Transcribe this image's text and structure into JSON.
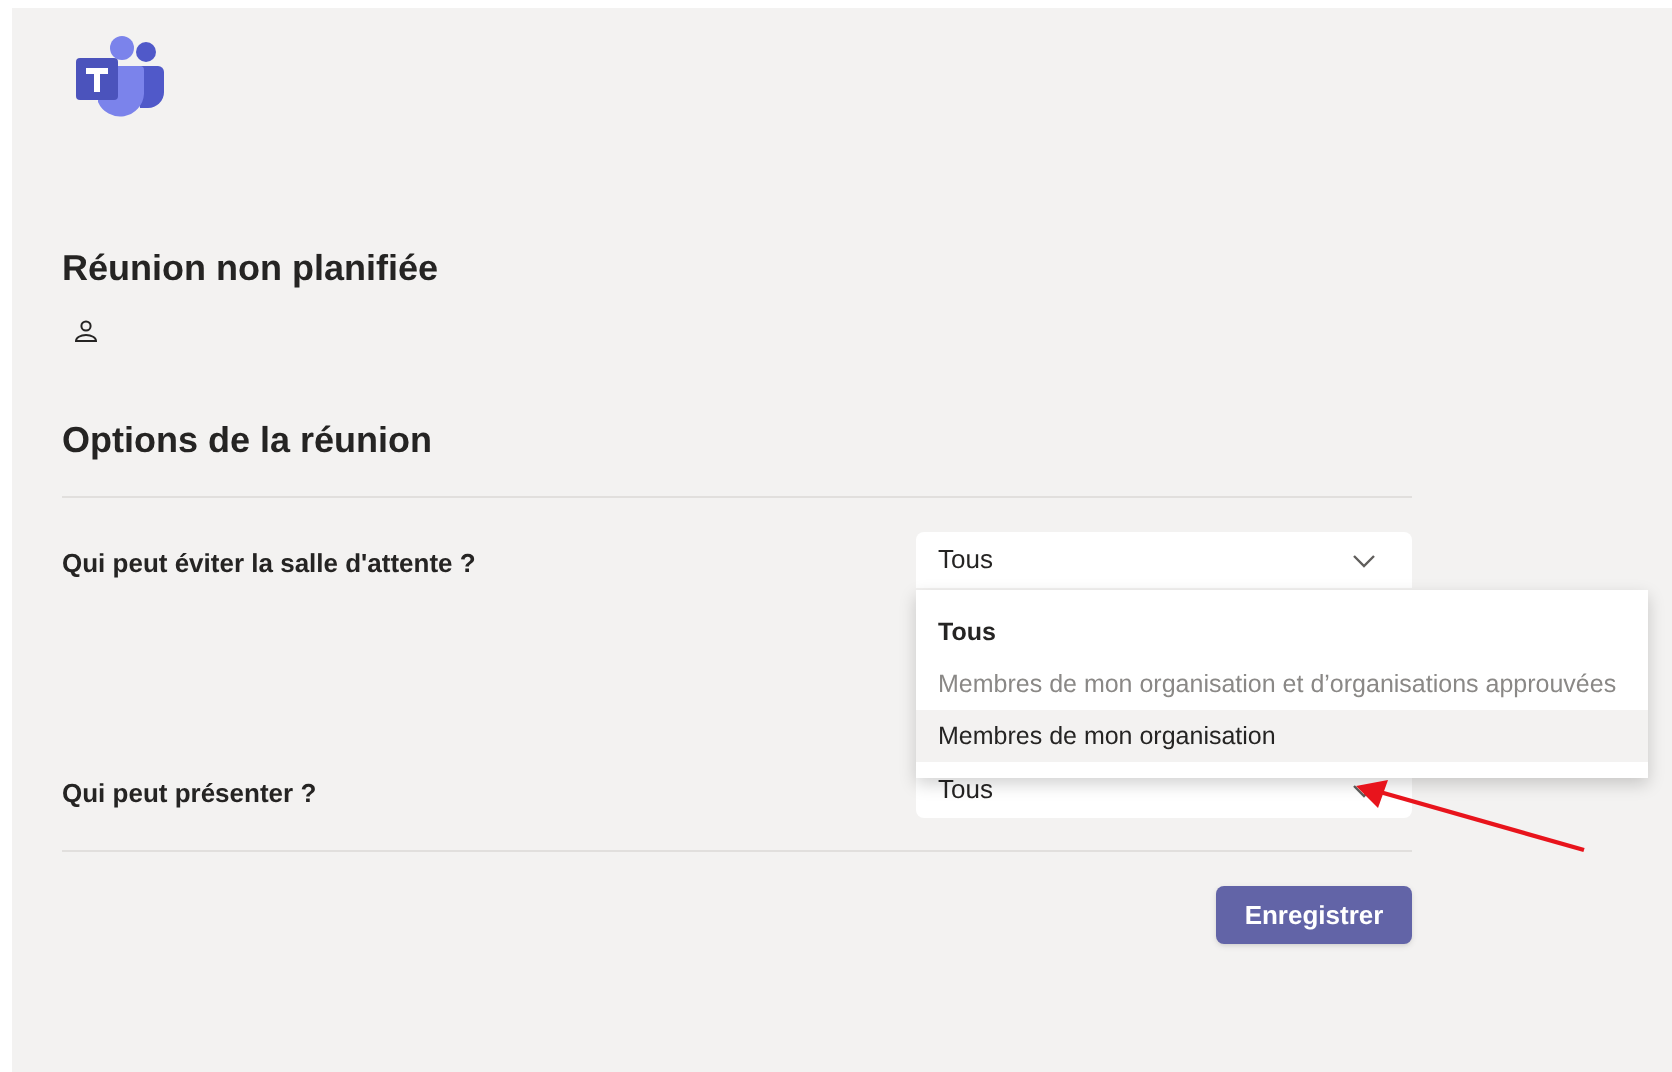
{
  "meeting": {
    "title": "Réunion non planifiée"
  },
  "options": {
    "heading": "Options de la réunion",
    "rows": [
      {
        "label": "Qui peut éviter la salle d'attente ?",
        "value": "Tous",
        "expanded": true,
        "choices": [
          {
            "label": "Tous",
            "selected": true,
            "disabled": false,
            "hovered": false
          },
          {
            "label": "Membres de mon organisation et d’organisations approuvées",
            "selected": false,
            "disabled": true,
            "hovered": false
          },
          {
            "label": "Membres de mon organisation",
            "selected": false,
            "disabled": false,
            "hovered": true
          }
        ]
      },
      {
        "label": "Qui peut présenter ?",
        "value": "Tous",
        "expanded": false
      }
    ]
  },
  "save_button": "Enregistrer"
}
